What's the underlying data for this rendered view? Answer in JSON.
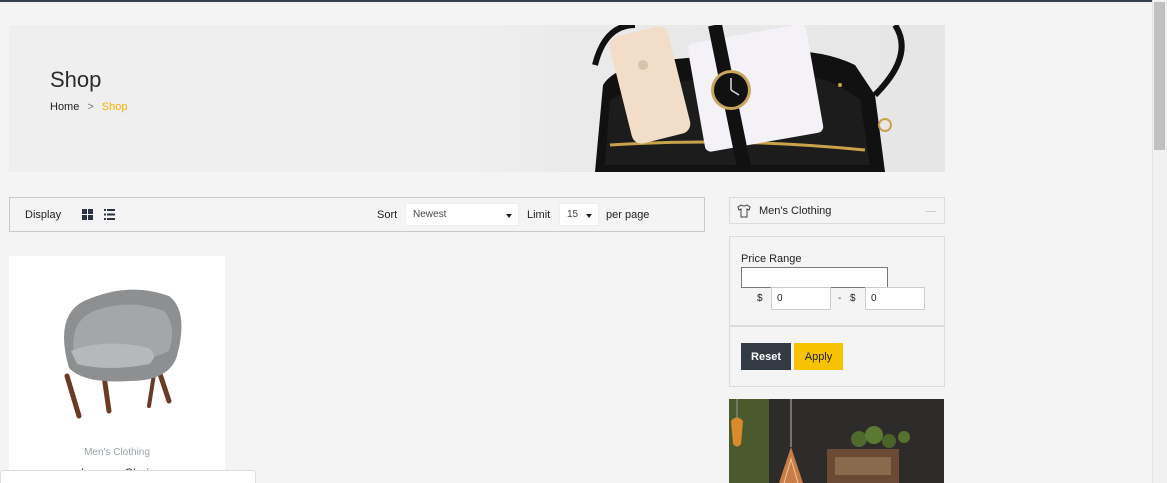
{
  "hero": {
    "title": "Shop",
    "breadcrumb": {
      "home": "Home",
      "separator": ">",
      "current": "Shop"
    }
  },
  "toolbar": {
    "display_label": "Display",
    "sort_label": "Sort",
    "sort_value": "Newest",
    "limit_label": "Limit",
    "limit_value": "15",
    "per_page_label": "per page"
  },
  "product": {
    "category": "Men's Clothing",
    "name": "Lounge Chair"
  },
  "sidebar": {
    "category": "Men's Clothing",
    "price_range_label": "Price Range",
    "currency": "$",
    "min_value": "0",
    "max_value": "0",
    "dash": "-",
    "reset_label": "Reset",
    "apply_label": "Apply"
  },
  "colors": {
    "accent": "#f7c200",
    "dark": "#323a44",
    "breadcrumb_current": "#f2b600"
  },
  "icons": [
    "grid-view-icon",
    "list-view-icon",
    "tshirt-icon",
    "chevron-down-icon"
  ]
}
